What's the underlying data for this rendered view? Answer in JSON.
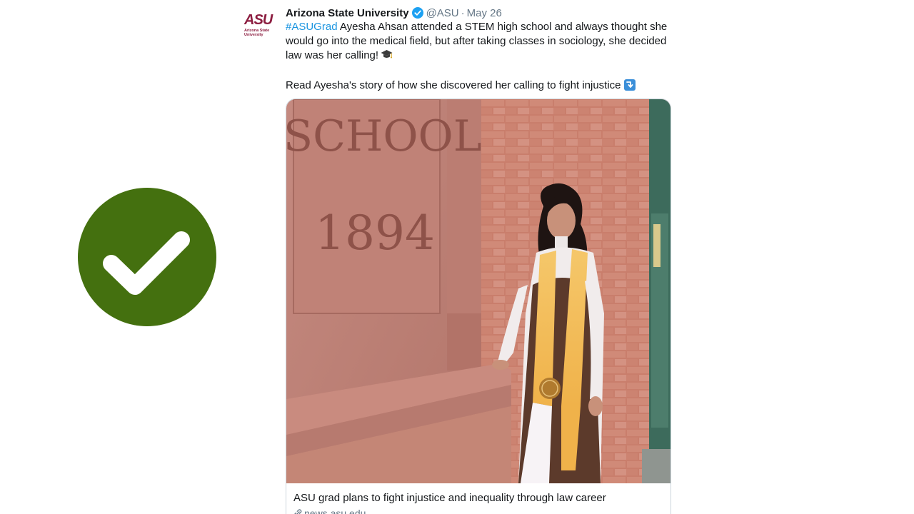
{
  "badge": {
    "icon": "checkmark-icon",
    "color": "#44700f"
  },
  "tweet": {
    "avatar": {
      "mark": "ASU",
      "subtext": "Arizona State University",
      "color": "#8c1d40"
    },
    "display_name": "Arizona State University",
    "verified_icon": "verified-badge-icon",
    "handle": "@ASU",
    "separator": "·",
    "date": "May 26",
    "hashtag": "#ASUGrad",
    "text_line1": " Ayesha Ahsan attended a STEM high school and always thought she would go into the medical field, but after taking classes in sociology, she decided law was her calling!",
    "emoji1": "graduation-cap-icon",
    "text_line2": "Read Ayesha's story of how she discovered her calling to fight injustice",
    "emoji2": "arrow-down-right-icon",
    "card": {
      "photo_text_top": "SCHOOL",
      "photo_text_year": "1894",
      "title": "ASU grad plans to fight injustice and inequality through law career",
      "domain": "news.asu.edu",
      "link_icon": "link-icon"
    }
  }
}
